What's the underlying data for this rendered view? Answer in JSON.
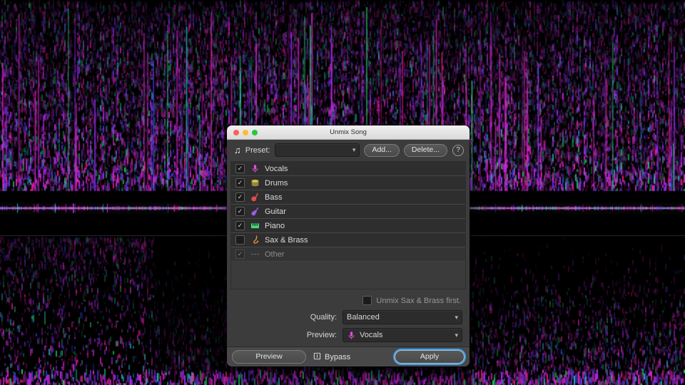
{
  "dialog": {
    "title": "Unmix Song",
    "titlebar": {
      "close_color": "#ff5f57",
      "minimize_color": "#febc2e",
      "zoom_color": "#28c840"
    },
    "preset": {
      "label": "Preset:",
      "value": "",
      "add_label": "Add...",
      "delete_label": "Delete...",
      "help_label": "?"
    },
    "stems": [
      {
        "label": "Vocals",
        "checked": true,
        "enabled": true,
        "color": "#e24fd8",
        "icon": "microphone-icon"
      },
      {
        "label": "Drums",
        "checked": true,
        "enabled": true,
        "color": "#d9c24a",
        "icon": "drum-icon"
      },
      {
        "label": "Bass",
        "checked": true,
        "enabled": true,
        "color": "#e04c4c",
        "icon": "bass-icon"
      },
      {
        "label": "Guitar",
        "checked": true,
        "enabled": true,
        "color": "#9b5be0",
        "icon": "guitar-icon"
      },
      {
        "label": "Piano",
        "checked": true,
        "enabled": true,
        "color": "#45d878",
        "icon": "piano-icon"
      },
      {
        "label": "Sax & Brass",
        "checked": false,
        "enabled": true,
        "color": "#e08a3c",
        "icon": "saxophone-icon"
      },
      {
        "label": "Other",
        "checked": true,
        "enabled": false,
        "color": "#7d93a8",
        "icon": "waves-icon"
      }
    ],
    "options": {
      "unmix_first_label": "Unmix Sax & Brass first.",
      "unmix_first_checked": false
    },
    "quality": {
      "label": "Quality:",
      "value": "Balanced"
    },
    "preview_select": {
      "label": "Preview:",
      "value": "Vocals",
      "color": "#e24fd8",
      "icon": "microphone-icon"
    },
    "footer": {
      "preview_label": "Preview",
      "bypass_label": "Bypass",
      "apply_label": "Apply",
      "apply_accent": "#4aa0e6"
    }
  },
  "background": {
    "base": "#000000",
    "palette": [
      "#e026d0",
      "#9b30ff",
      "#4040e8",
      "#20d070",
      "#ff2090",
      "#20c0c8"
    ]
  }
}
